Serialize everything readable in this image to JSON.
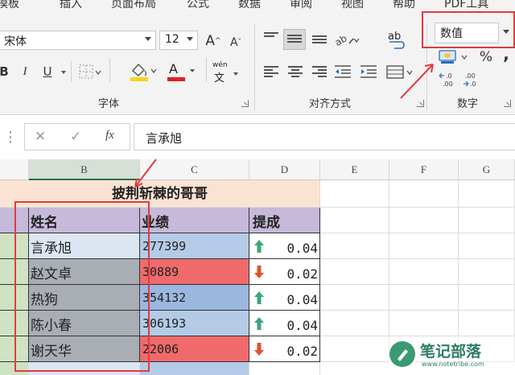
{
  "ribbon": {
    "tabs": [
      "模板",
      "插入",
      "页面布局",
      "公式",
      "数据",
      "审阅",
      "视图",
      "帮助",
      "PDF工具"
    ],
    "font_name": "宋体",
    "font_size": "12",
    "grow_font": "A",
    "shrink_font": "A",
    "bold": "B",
    "italic": "I",
    "underline": "U",
    "font_color_glyph": "A",
    "phonetic_glyph": "wén",
    "wrap_glyph": "ab",
    "number_format": "数值",
    "percent": "%",
    "comma": ",",
    "increase_decimal": "←.0 .00",
    "decrease_decimal": ".00 →.0",
    "groups": {
      "font": "字体",
      "alignment": "对齐方式",
      "number": "数字"
    },
    "colors": {
      "highlight": "#e23b3b",
      "fill_yellow": "#f5d51c",
      "font_red": "#e02020"
    }
  },
  "formula_bar": {
    "cancel": "✕",
    "enter": "✓",
    "fx": "fx",
    "content": "言承旭"
  },
  "sheet": {
    "columns": [
      "B",
      "C",
      "D",
      "E",
      "F",
      "G"
    ],
    "title": "披荆斩棘的哥哥",
    "headers": [
      "姓名",
      "业绩",
      "提成"
    ],
    "rows": [
      {
        "name": "言承旭",
        "sales": "277399",
        "rate": "0.04",
        "trend": "up"
      },
      {
        "name": "赵文卓",
        "sales": "30889",
        "rate": "0.02",
        "trend": "down"
      },
      {
        "name": "热狗",
        "sales": "354132",
        "rate": "0.04",
        "trend": "up"
      },
      {
        "name": "陈小春",
        "sales": "306193",
        "rate": "0.04",
        "trend": "up"
      },
      {
        "name": "谢天华",
        "sales": "22006",
        "rate": "0.02",
        "trend": "down"
      }
    ],
    "colors": {
      "title_fill": "#fbe3d3",
      "header_fill": "#c6b9d9",
      "name_selected": "#a9aeb4",
      "name_first": "#dce6f2",
      "sales_high": "#b4cbe8",
      "sales_mid": "#9cb7df",
      "sales_low": "#ef6b6b",
      "arrow_up": "#3aa77a",
      "arrow_down": "#e2512a"
    }
  },
  "watermark": {
    "text": "笔记部落",
    "url": "www.notetribe.com"
  }
}
